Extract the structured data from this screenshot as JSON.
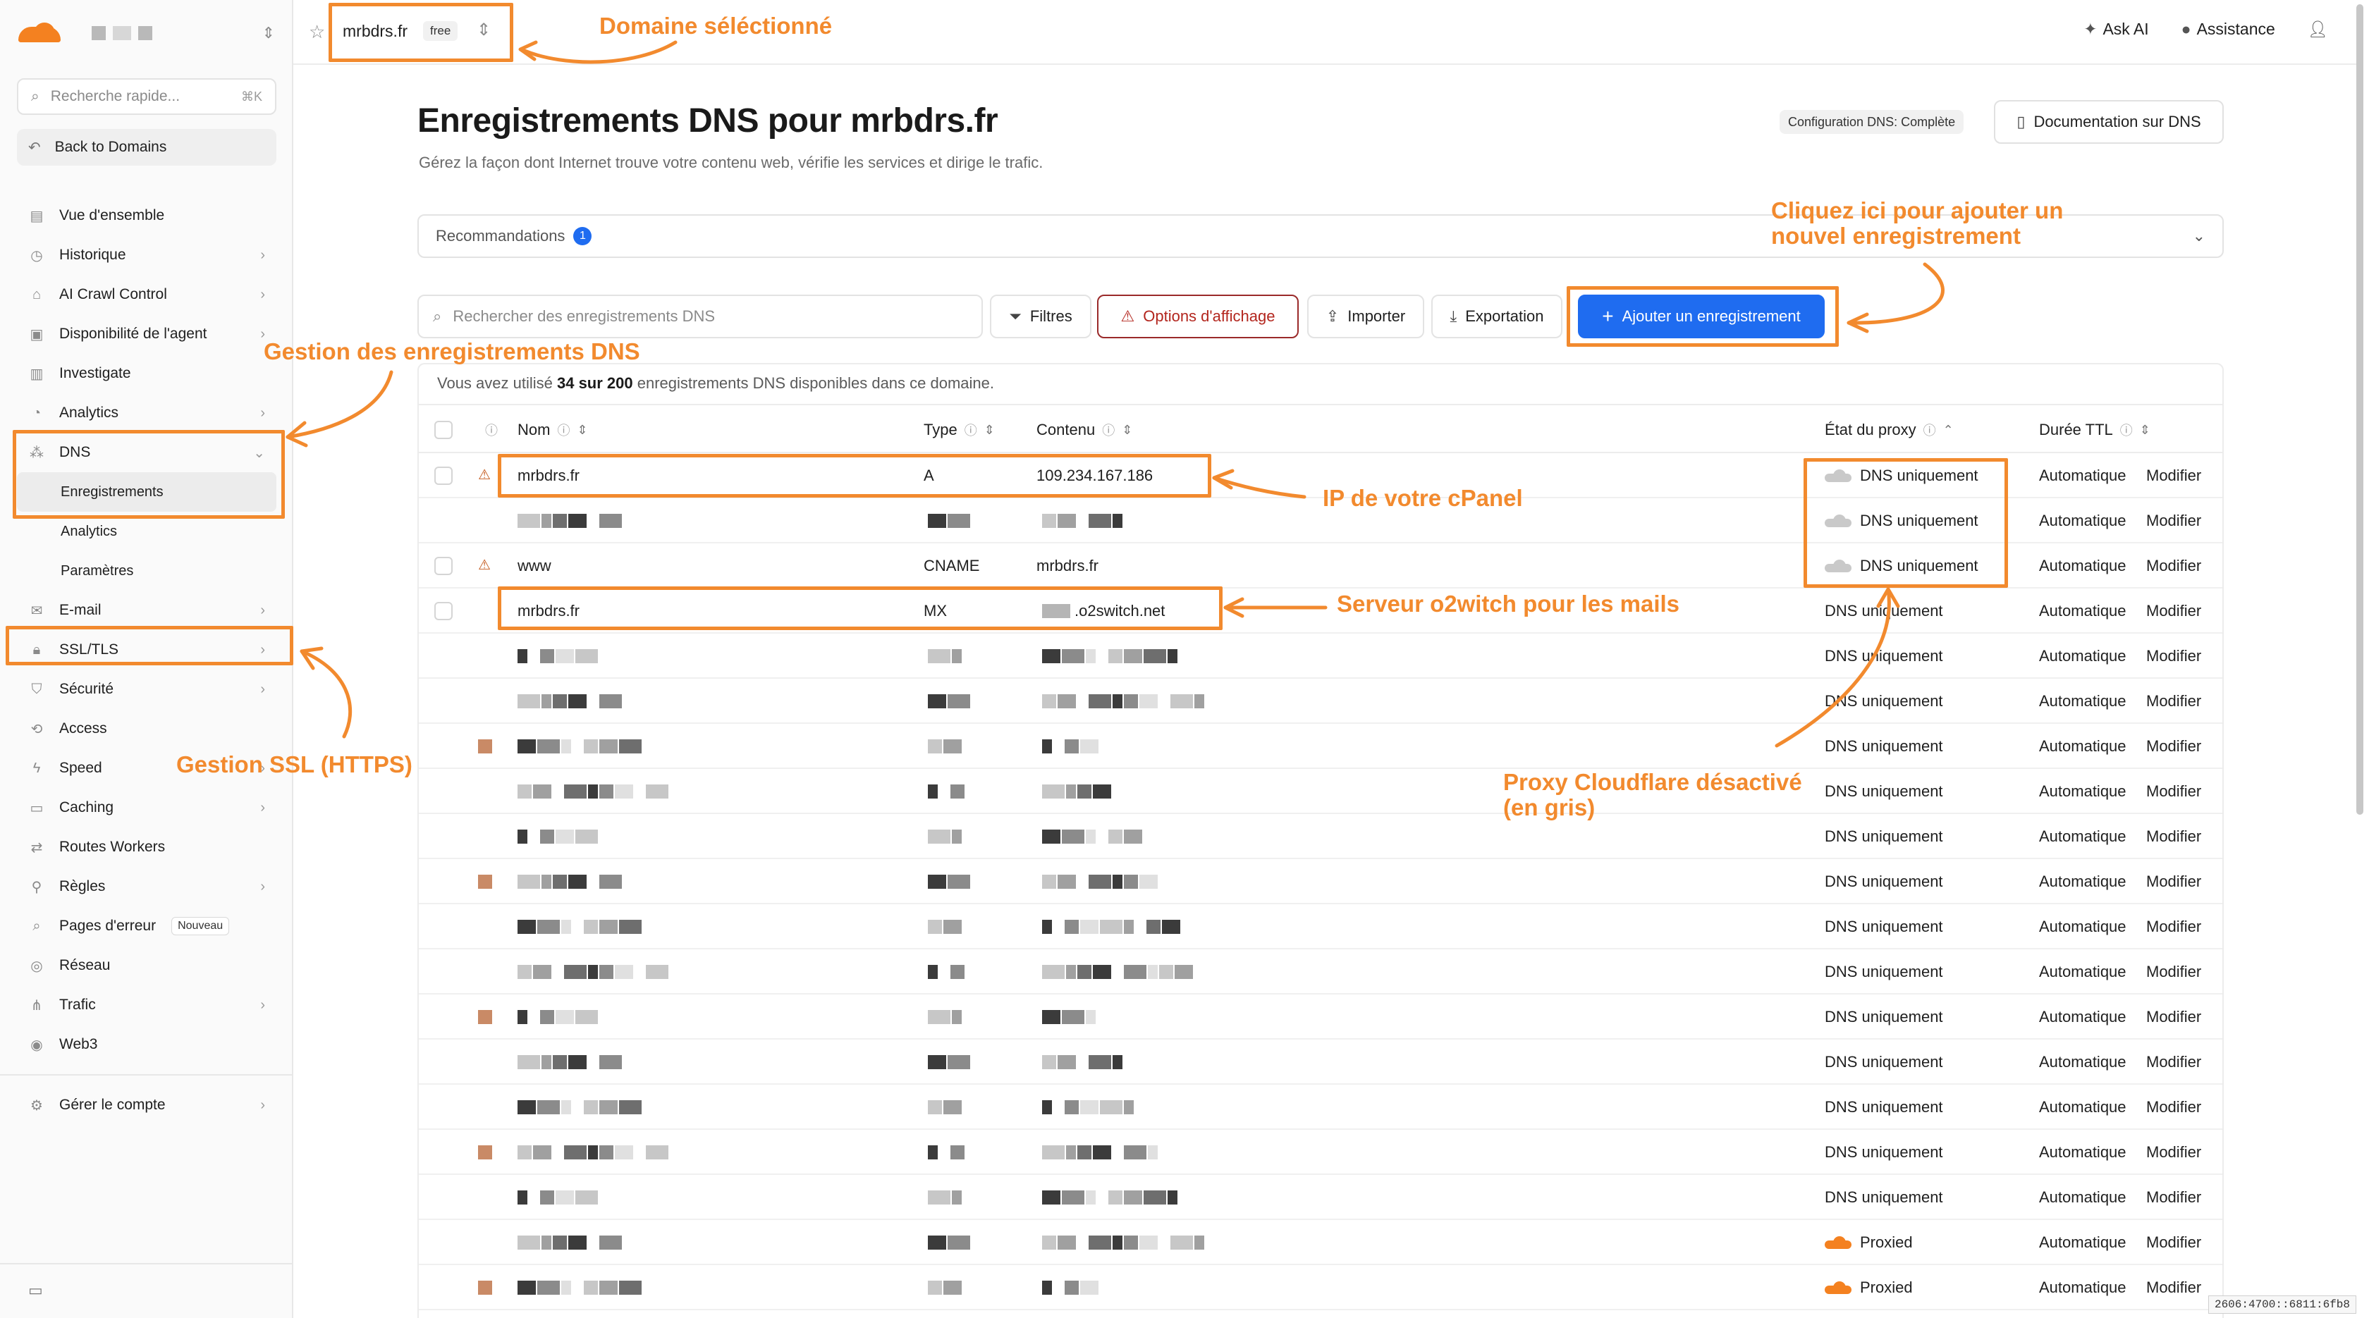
{
  "sidebar": {
    "search_placeholder": "Recherche rapide...",
    "search_shortcut": "⌘K",
    "back_label": "Back to Domains",
    "items": [
      {
        "label": "Vue d'ensemble",
        "icon": "document-icon",
        "chevron": false
      },
      {
        "label": "Historique",
        "icon": "history-icon",
        "chevron": true
      },
      {
        "label": "AI Crawl Control",
        "icon": "robot-icon",
        "chevron": true
      },
      {
        "label": "Disponibilité de l'agent",
        "icon": "agent-icon",
        "chevron": true
      },
      {
        "label": "Investigate",
        "icon": "investigate-icon",
        "chevron": true
      },
      {
        "label": "Analytics",
        "icon": "analytics-icon",
        "chevron": true
      }
    ],
    "dns": {
      "label": "DNS",
      "sub": [
        "Enregistrements",
        "Analytics",
        "Paramètres"
      ]
    },
    "items2": [
      {
        "label": "E-mail",
        "icon": "mail-icon",
        "chevron": true
      },
      {
        "label": "SSL/TLS",
        "icon": "lock-icon",
        "chevron": true
      },
      {
        "label": "Sécurité",
        "icon": "shield-icon",
        "chevron": true
      },
      {
        "label": "Access",
        "icon": "access-icon",
        "chevron": false
      },
      {
        "label": "Speed",
        "icon": "lightning-icon",
        "chevron": true
      },
      {
        "label": "Caching",
        "icon": "caching-icon",
        "chevron": true
      },
      {
        "label": "Routes Workers",
        "icon": "workers-icon",
        "chevron": false
      },
      {
        "label": "Règles",
        "icon": "rules-icon",
        "chevron": true
      },
      {
        "label": "Pages d'erreur",
        "icon": "error-page-icon",
        "chevron": false,
        "badge": "Nouveau"
      },
      {
        "label": "Réseau",
        "icon": "network-icon",
        "chevron": false
      },
      {
        "label": "Trafic",
        "icon": "traffic-icon",
        "chevron": true
      },
      {
        "label": "Web3",
        "icon": "web3-icon",
        "chevron": false
      }
    ],
    "manage_account": "Gérer le compte"
  },
  "topbar": {
    "domain": "mrbdrs.fr",
    "plan": "free",
    "ask_ai": "Ask AI",
    "assistance": "Assistance"
  },
  "page": {
    "title": "Enregistrements DNS pour mrbdrs.fr",
    "subtitle": "Gérez la façon dont Internet trouve votre contenu web, vérifie les services et dirige le trafic.",
    "config_pill": "Configuration DNS: Complète",
    "doc_button": "Documentation sur DNS",
    "recommendations": "Recommandations",
    "recommendations_count": "1"
  },
  "toolbar": {
    "search_placeholder": "Rechercher des enregistrements DNS",
    "filters": "Filtres",
    "display_options": "Options d'affichage",
    "import": "Importer",
    "export": "Exportation",
    "add_record": "Ajouter un enregistrement"
  },
  "usage": {
    "prefix": "Vous avez utilisé ",
    "count": "34 sur 200",
    "suffix": " enregistrements DNS disponibles dans ce domaine."
  },
  "table": {
    "headers": {
      "name": "Nom",
      "type": "Type",
      "content": "Contenu",
      "proxy": "État du proxy",
      "ttl": "Durée TTL"
    },
    "rows": [
      {
        "warn": true,
        "name": "mrbdrs.fr",
        "type": "A",
        "content": "109.234.167.186",
        "proxy": "DNS uniquement",
        "cloud": "grey",
        "ttl": "Automatique",
        "edit": "Modifier"
      },
      {
        "blurred": true,
        "proxy": "DNS uniquement",
        "cloud": "grey",
        "ttl": "Automatique",
        "edit": "Modifier"
      },
      {
        "warn": true,
        "name": "www",
        "type": "CNAME",
        "content": "mrbdrs.fr",
        "proxy": "DNS uniquement",
        "cloud": "grey",
        "ttl": "Automatique",
        "edit": "Modifier"
      },
      {
        "name": "mrbdrs.fr",
        "type": "MX",
        "content": ".o2switch.net",
        "proxy": "DNS uniquement",
        "ttl": "Automatique",
        "edit": "Modifier"
      },
      {
        "blurred": true,
        "proxy": "DNS uniquement",
        "ttl": "Automatique",
        "edit": "Modifier"
      },
      {
        "blurred": true,
        "proxy": "DNS uniquement",
        "ttl": "Automatique",
        "edit": "Modifier"
      },
      {
        "blurred": true,
        "proxy": "DNS uniquement",
        "ttl": "Automatique",
        "edit": "Modifier"
      },
      {
        "blurred": true,
        "proxy": "DNS uniquement",
        "ttl": "Automatique",
        "edit": "Modifier"
      },
      {
        "blurred": true,
        "proxy": "DNS uniquement",
        "ttl": "Automatique",
        "edit": "Modifier"
      },
      {
        "blurred": true,
        "proxy": "DNS uniquement",
        "ttl": "Automatique",
        "edit": "Modifier"
      },
      {
        "blurred": true,
        "proxy": "DNS uniquement",
        "ttl": "Automatique",
        "edit": "Modifier"
      },
      {
        "blurred": true,
        "proxy": "DNS uniquement",
        "ttl": "Automatique",
        "edit": "Modifier"
      },
      {
        "blurred": true,
        "proxy": "DNS uniquement",
        "ttl": "Automatique",
        "edit": "Modifier"
      },
      {
        "blurred": true,
        "proxy": "DNS uniquement",
        "ttl": "Automatique",
        "edit": "Modifier"
      },
      {
        "blurred": true,
        "proxy": "DNS uniquement",
        "ttl": "Automatique",
        "edit": "Modifier"
      },
      {
        "blurred": true,
        "proxy": "DNS uniquement",
        "ttl": "Automatique",
        "edit": "Modifier"
      },
      {
        "blurred": true,
        "proxy": "DNS uniquement",
        "ttl": "Automatique",
        "edit": "Modifier"
      },
      {
        "blurred": true,
        "proxy": "Proxied",
        "cloud": "orange",
        "ttl": "Automatique",
        "edit": "Modifier"
      },
      {
        "blurred": true,
        "proxy": "Proxied",
        "cloud": "orange",
        "ttl": "Automatique",
        "edit": "Modifier"
      }
    ]
  },
  "annotations": {
    "domaine": "Domaine séléctionné",
    "gestion_dns": "Gestion des enregistrements DNS",
    "gestion_ssl": "Gestion SSL (HTTPS)",
    "cliquez": [
      "Cliquez ici pour ajouter un",
      "nouvel enregistrement"
    ],
    "ip_cpanel": "IP de votre cPanel",
    "serveur_mail": "Serveur o2witch pour les mails",
    "proxy": [
      "Proxy Cloudflare désactivé",
      "(en gris)"
    ]
  },
  "ip_readout": "2606:4700::6811:6fb8",
  "colors": {
    "accent": "#1f6cf0",
    "annotation": "#f28a2e",
    "cloudflare_orange": "#f48120",
    "warning": "#b3261e"
  }
}
